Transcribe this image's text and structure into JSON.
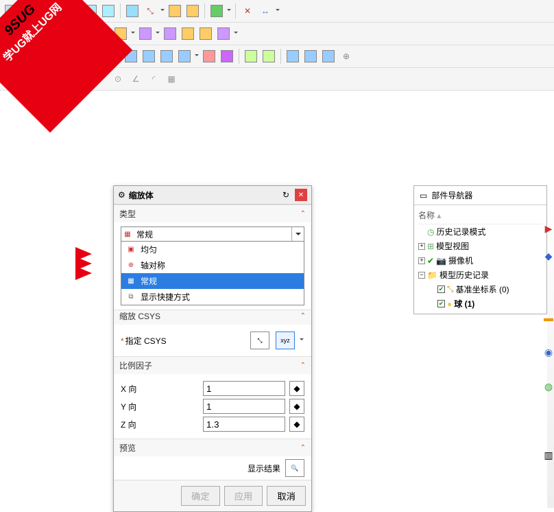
{
  "watermark": {
    "line1": "9SUG",
    "line2": "学UG就上UG网"
  },
  "dialog": {
    "title": "缩放体",
    "sect_type": "类型",
    "type_value": "常规",
    "options": [
      {
        "label": "均匀"
      },
      {
        "label": "轴对称"
      },
      {
        "label": "常规",
        "selected": true
      },
      {
        "label": "显示快捷方式"
      }
    ],
    "sect_csys": "缩放 CSYS",
    "specify_csys": "指定 CSYS",
    "sect_scale": "比例因子",
    "x_label": "X 向",
    "y_label": "Y 向",
    "z_label": "Z 向",
    "x_val": "1",
    "y_val": "1",
    "z_val": "1.3",
    "sect_preview": "预览",
    "show_result": "显示结果",
    "ok": "确定",
    "apply": "应用",
    "cancel": "取消"
  },
  "nav": {
    "title": "部件导航器",
    "col_name": "名称",
    "items": {
      "history_mode": "历史记录模式",
      "model_view": "模型视图",
      "camera": "摄像机",
      "model_history": "模型历史记录",
      "datum_csys": "基准坐标系 (0)",
      "sphere": "球 (1)"
    }
  }
}
